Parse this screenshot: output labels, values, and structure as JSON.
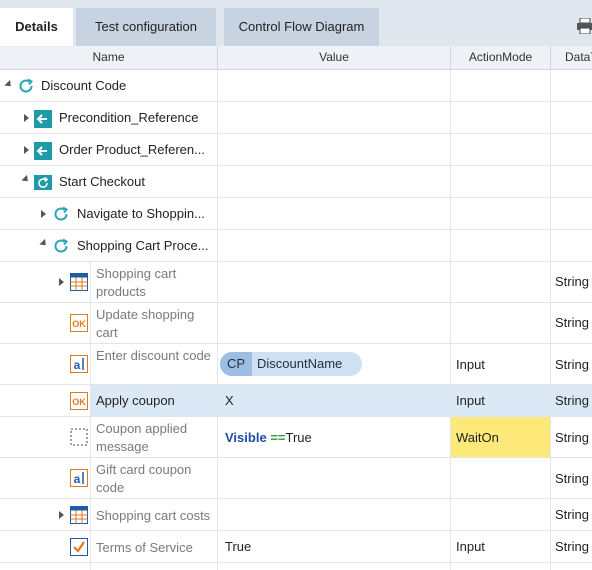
{
  "tabs": [
    {
      "label": "Details",
      "active": true
    },
    {
      "label": "Test configuration",
      "active": false
    },
    {
      "label": "Control Flow Diagram",
      "active": false
    }
  ],
  "toolbar": {
    "print_icon": "printer-icon"
  },
  "columns": [
    "Name",
    "Value",
    "ActionMode",
    "DataT"
  ],
  "rows": [
    {
      "name": "Discount Code",
      "icon": "loop-icon",
      "value": "",
      "mode": "",
      "type": ""
    },
    {
      "name": "Precondition_Reference",
      "icon": "reference-icon",
      "value": "",
      "mode": "",
      "type": ""
    },
    {
      "name": "Order Product_Referen...",
      "icon": "reference-icon",
      "value": "",
      "mode": "",
      "type": ""
    },
    {
      "name": "Start Checkout",
      "icon": "folder-loop-icon",
      "value": "",
      "mode": "",
      "type": ""
    },
    {
      "name": "Navigate to Shoppin...",
      "icon": "loop-icon",
      "value": "",
      "mode": "",
      "type": ""
    },
    {
      "name": "Shopping Cart Proce...",
      "icon": "loop-icon",
      "value": "",
      "mode": "",
      "type": ""
    },
    {
      "name": "Shopping cart products",
      "icon": "table-icon",
      "value": "",
      "mode": "",
      "type": "String"
    },
    {
      "name": "Update shopping cart",
      "icon": "ok-button-icon",
      "value": "",
      "mode": "",
      "type": "String"
    },
    {
      "name": "Enter discount code",
      "icon": "textbox-icon",
      "value": "",
      "chip_cp": "CP",
      "chip_name": "DiscountName",
      "mode": "Input",
      "type": "String"
    },
    {
      "name": "Apply coupon",
      "icon": "ok-button-icon",
      "value": "X",
      "mode": "Input",
      "type": "String"
    },
    {
      "name": "Coupon applied message",
      "icon": "dashed-box-icon",
      "value_keyword": "Visible",
      "value_op": "==",
      "value_rest": "True",
      "mode": "WaitOn",
      "type": "String"
    },
    {
      "name": "Gift card coupon code",
      "icon": "textbox-icon",
      "value": "",
      "mode": "",
      "type": "String"
    },
    {
      "name": "Shopping cart costs",
      "icon": "table-icon",
      "value": "",
      "mode": "",
      "type": "String"
    },
    {
      "name": "Terms of Service",
      "icon": "checkbox-icon",
      "value": "True",
      "mode": "Input",
      "type": "String"
    }
  ]
}
